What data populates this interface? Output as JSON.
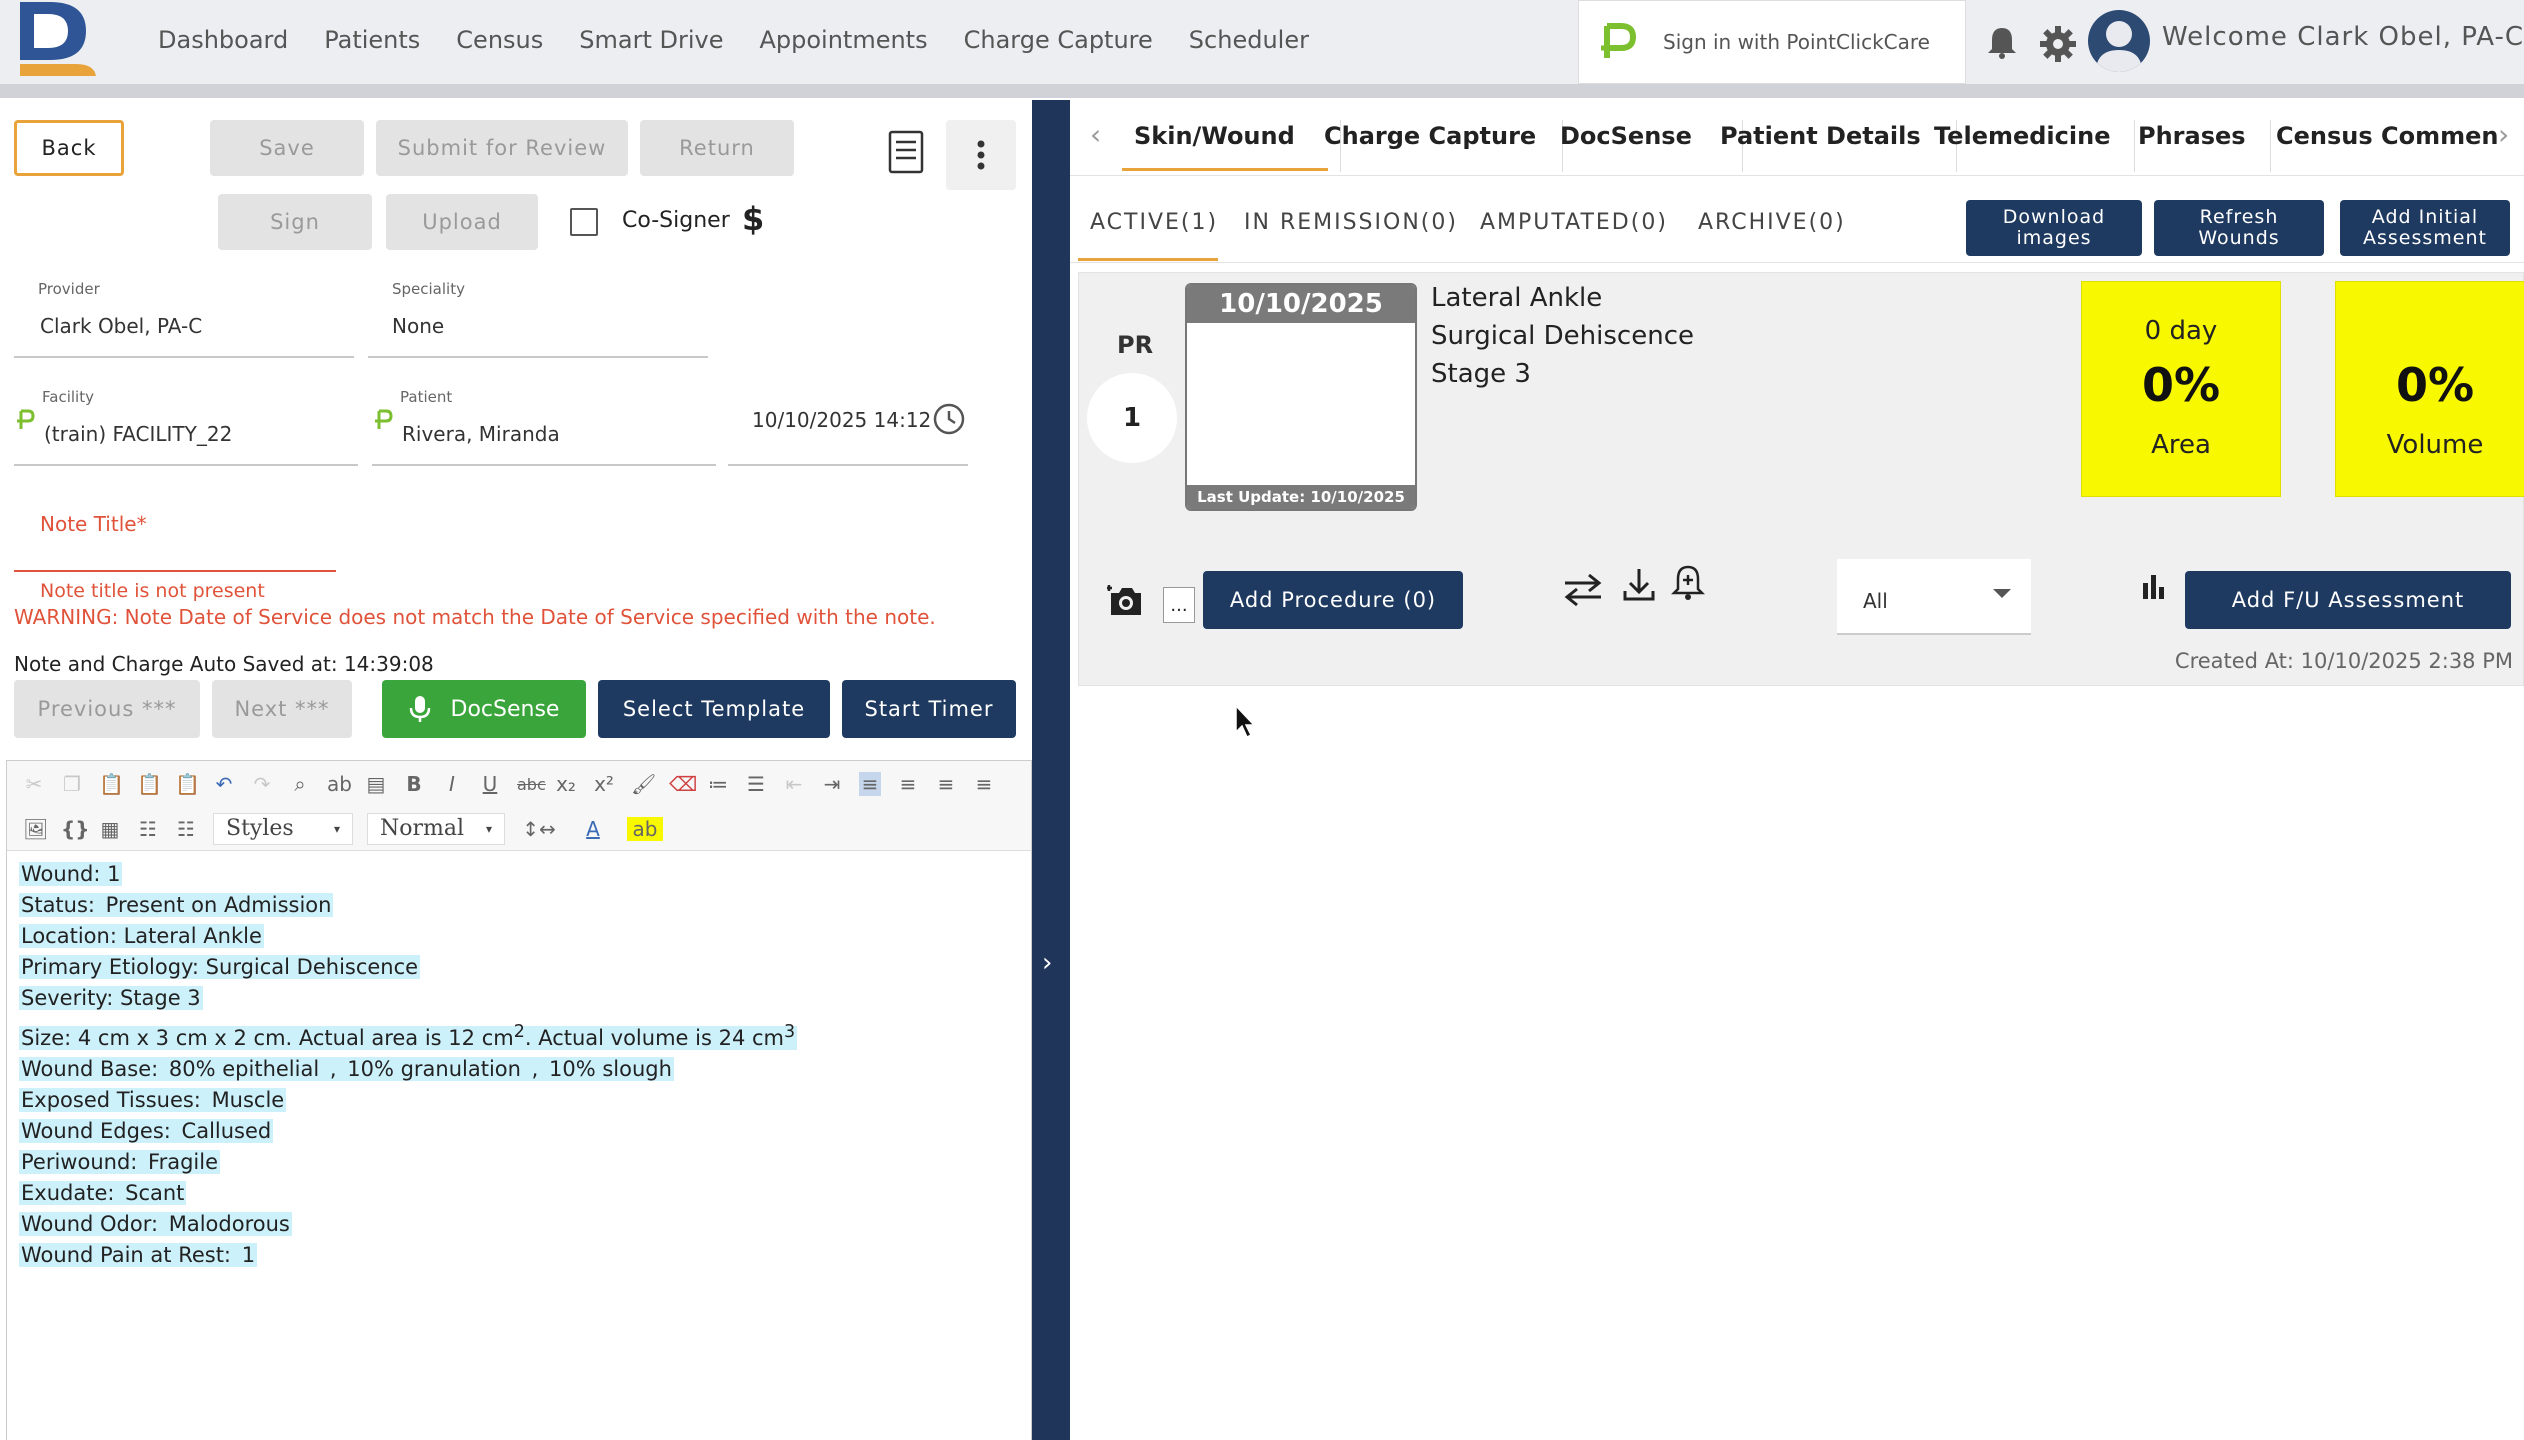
{
  "nav": {
    "items": [
      "Dashboard",
      "Patients",
      "Census",
      "Smart Drive",
      "Appointments",
      "Charge Capture",
      "Scheduler"
    ],
    "pcc_signin": "Sign in with PointClickCare",
    "welcome": "Welcome Clark Obel, PA-C"
  },
  "toolbar": {
    "back": "Back",
    "save": "Save",
    "submit_review": "Submit for Review",
    "return": "Return",
    "sign": "Sign",
    "upload": "Upload",
    "cosigner": "Co-Signer"
  },
  "form": {
    "provider_label": "Provider",
    "provider_value": "Clark Obel, PA-C",
    "speciality_label": "Speciality",
    "speciality_value": "None",
    "facility_label": "Facility",
    "facility_value": "(train) FACILITY_22",
    "patient_label": "Patient",
    "patient_value": "Rivera, Miranda",
    "datetime_value": "10/10/2025 14:12",
    "note_title_placeholder": "Note Title*",
    "note_title_error": "Note title is not present",
    "warning": "WARNING: Note Date of Service does not match the Date of Service specified with the note.",
    "autosave": "Note and Charge Auto Saved at: 14:39:08"
  },
  "actions": {
    "previous": "Previous ***",
    "next": "Next ***",
    "docsense": "DocSense",
    "select_template": "Select Template",
    "start_timer": "Start Timer"
  },
  "editor": {
    "styles_select": "Styles",
    "format_select": "Normal",
    "lines": [
      {
        "label": "Wound: 1",
        "value": ""
      },
      {
        "label": "Status: ",
        "value": " Present on Admission "
      },
      {
        "label": "Location: Lateral Ankle",
        "value": ""
      },
      {
        "label": "Primary Etiology: Surgical Dehiscence",
        "value": ""
      },
      {
        "label": "Severity: Stage 3",
        "value": ""
      }
    ],
    "size_line": {
      "a": "Size: 4 cm x 3 cm x 2 cm. Actual area is 12 cm",
      "sup1": "2",
      "b": ". Actual volume is 24 cm",
      "sup2": "3"
    },
    "wound_base": {
      "label": "Wound Base: ",
      "v1": " 80% epithelial ",
      "sep1": ", ",
      "v2": " 10% granulation ",
      "sep2": ", ",
      "v3": " 10% slough "
    },
    "rest": [
      {
        "label": "Exposed Tissues: ",
        "value": " Muscle "
      },
      {
        "label": "Wound Edges: ",
        "value": " Callused "
      },
      {
        "label": "Periwound: ",
        "value": " Fragile "
      },
      {
        "label": "Exudate: ",
        "value": " Scant "
      },
      {
        "label": "Wound Odor: ",
        "value": " Malodorous "
      },
      {
        "label": "Wound Pain at Rest: ",
        "value": " 1 "
      }
    ]
  },
  "right": {
    "tabs": [
      "Skin/Wound",
      "Charge Capture",
      "DocSense",
      "Patient Details",
      "Telemedicine",
      "Phrases",
      "Census Commen"
    ],
    "subtabs": [
      "ACTIVE(1)",
      "IN REMISSION(0)",
      "AMPUTATED(0)",
      "ARCHIVE(0)"
    ],
    "download_images": [
      "Download",
      "images"
    ],
    "refresh_wounds": [
      "Refresh",
      "Wounds"
    ],
    "add_initial": [
      "Add Initial",
      "Assessment"
    ],
    "wound": {
      "prefix": "PR",
      "number": "1",
      "date": "10/10/2025",
      "last_update": "Last Update: 10/10/2025",
      "location": "Lateral Ankle",
      "etiology": "Surgical Dehiscence",
      "stage": "Stage 3",
      "area_days": "0 day",
      "area_pct": "0%",
      "area_label": "Area",
      "volume_pct": "0%",
      "volume_label": "Volume",
      "more_btn": "...",
      "add_procedure": "Add Procedure (0)",
      "filter_value": "All",
      "add_fu": "Add F/U Assessment",
      "created": "Created At: 10/10/2025 2:38 PM"
    }
  },
  "colors": {
    "navy": "#1f3a60",
    "accent_orange": "#e8a33a",
    "highlight_yellow": "#f8f800",
    "docsense_green": "#3aa53a",
    "error_red": "#e0533a"
  }
}
